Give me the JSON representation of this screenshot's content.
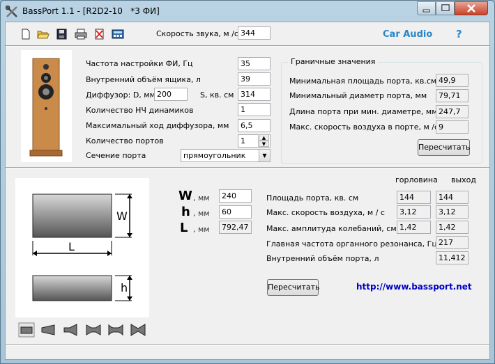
{
  "window": {
    "title": "BassPort 1.1 - [R2D2-10   *3 ФИ]"
  },
  "toolbar": {
    "buttons": [
      "new-icon",
      "open-icon",
      "save-icon",
      "print-icon",
      "delete-icon",
      "calculator-icon"
    ],
    "sound_speed_label": "Скорость звука, м /с",
    "sound_speed_value": "344",
    "car_audio_label": "Car Audio",
    "help_label": "?"
  },
  "params": {
    "tuning_freq_label": "Частота настройки ФИ, Гц",
    "tuning_freq_value": "35",
    "box_volume_label": "Внутренний объём ящика, л",
    "box_volume_value": "39",
    "diffuser_d_label": "Диффузор: D, мм",
    "diffuser_d_value": "200",
    "diffuser_s_label": "S, кв. см",
    "diffuser_s_value": "314",
    "drivers_label": "Количество НЧ динамиков",
    "drivers_value": "1",
    "excursion_label": "Максимальный ход диффузора, мм",
    "excursion_value": "6,5",
    "ports_label": "Количество портов",
    "ports_value": "1",
    "section_label": "Сечение порта",
    "section_value": "прямоугольник"
  },
  "limits": {
    "title": "Граничные значения",
    "min_area_label": "Минимальная площадь порта, кв.см",
    "min_area_value": "49,9",
    "min_diam_label": "Минимальный диаметр порта, мм",
    "min_diam_value": "79,71",
    "len_label": "Длина порта при мин. диаметре, мм",
    "len_value": "247,7",
    "max_speed_label": "Макс. скорость воздуха в порте, м /с",
    "max_speed_value": "9",
    "recalc_label": "Пересчитать"
  },
  "port": {
    "diagram_w": "W",
    "diagram_l": "L",
    "diagram_h": "h",
    "w_letter": "W",
    "h_letter": "h",
    "l_letter": "L",
    "unit": ", мм",
    "w_value": "240",
    "h_value": "60",
    "l_value": "792,47",
    "col_throat": "горловина",
    "col_exit": "выход",
    "area_label": "Площадь порта, кв. см",
    "area_throat": "144",
    "area_exit": "144",
    "speed_label": "Макс. скорость воздуха, м / с",
    "speed_throat": "3,12",
    "speed_exit": "3,12",
    "amp_label": "Макс. амплитуда колебаний, см",
    "amp_throat": "1,42",
    "amp_exit": "1,42",
    "organ_label": "Главная частота органного резонанса, Гц",
    "organ_value": "217",
    "port_volume_label": "Внутренний объём порта, л",
    "port_volume_value": "11,412",
    "recalc_label": "Пересчитать",
    "website": "http://www.bassport.net"
  },
  "shape_tabs": [
    "rect-port-icon",
    "cone-port-icon",
    "horn-port-icon",
    "double-cone-icon",
    "flared-port-icon",
    "bow-tie-port-icon"
  ]
}
